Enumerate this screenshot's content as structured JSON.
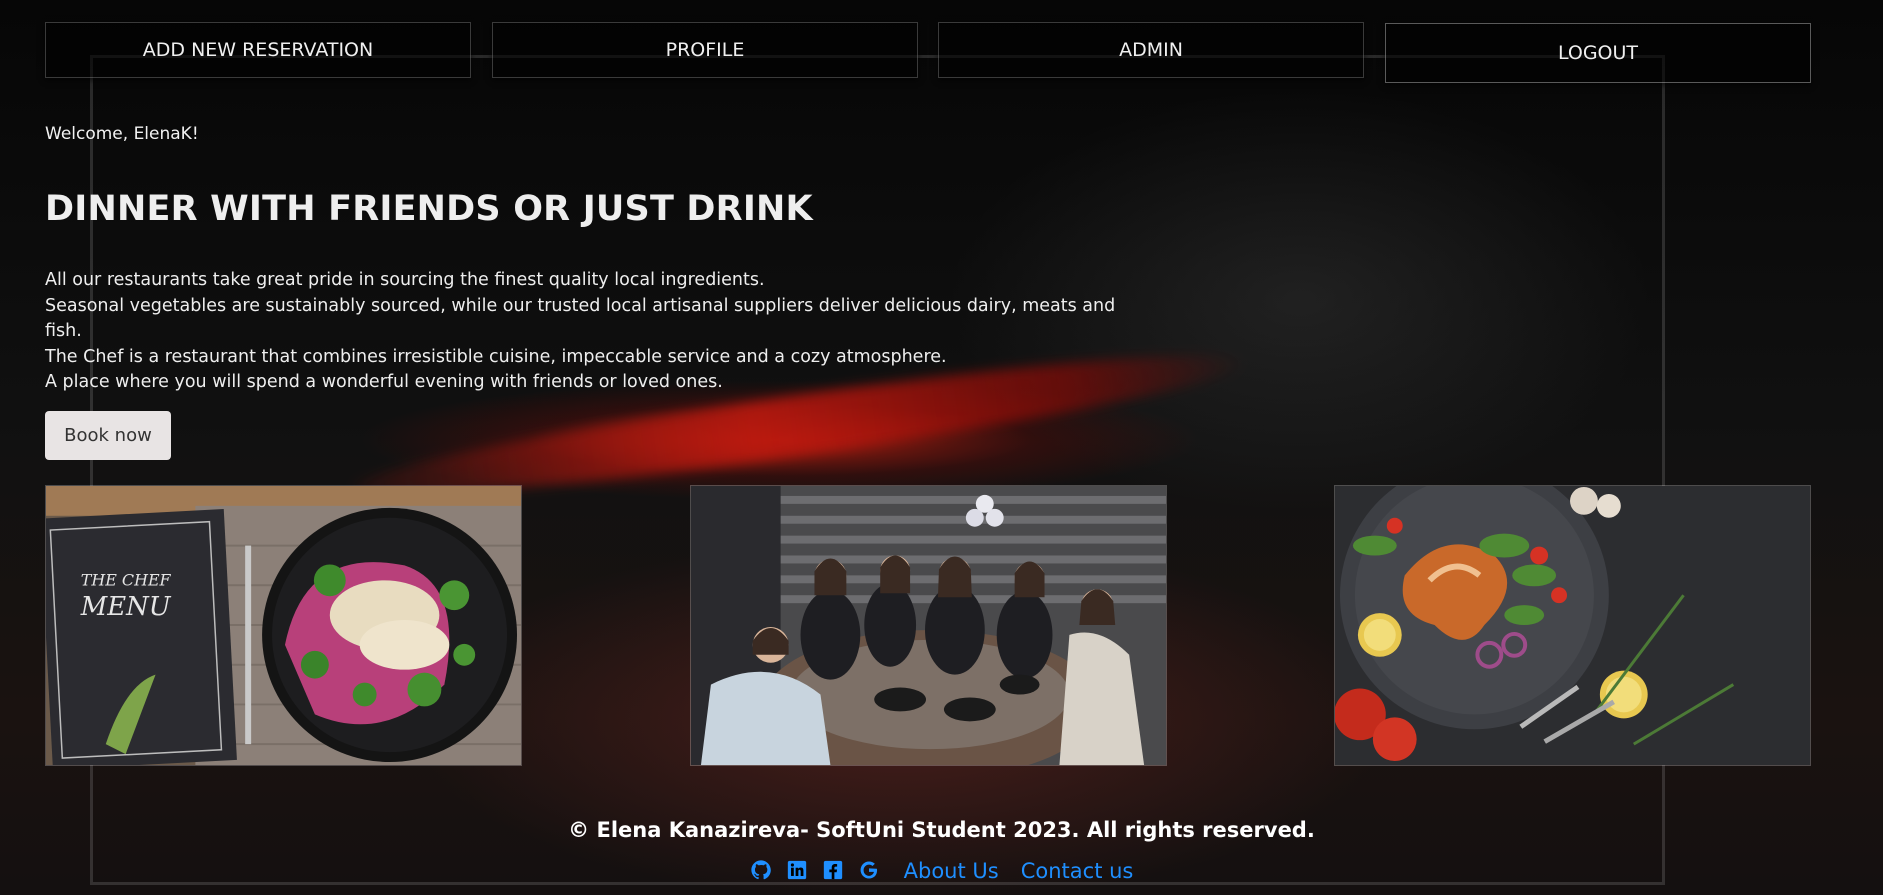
{
  "nav": {
    "add_reservation": "ADD NEW RESERVATION",
    "profile": "PROFILE",
    "admin": "ADMIN",
    "logout": "LOGOUT"
  },
  "welcome": "Welcome, ElenaK!",
  "hero": {
    "title": "DINNER WITH FRIENDS OR JUST DRINK",
    "paragraphs": [
      "All our restaurants take great pride in sourcing the finest quality local ingredients.",
      "Seasonal vegetables are sustainably sourced, while our trusted local artisanal suppliers deliver delicious dairy, meats and fish.",
      "The Chef is a restaurant that combines irresistible cuisine, impeccable service and a cozy atmosphere.",
      "A place where you will spend a wonderful evening with friends or loved ones."
    ],
    "book_button": "Book now"
  },
  "gallery": {
    "menu_card_title": "THE CHEF",
    "menu_card_subtitle": "MENU"
  },
  "footer": {
    "copyright": "© Elena Kanazireva- SoftUni Student 2023. All rights reserved.",
    "icons": [
      "github-icon",
      "linkedin-icon",
      "facebook-icon",
      "google-icon"
    ],
    "about": "About Us",
    "contact": "Contact us"
  },
  "colors": {
    "link": "#1f8fff",
    "book_button_bg": "#e8e4e4",
    "background": "#0b0b0b"
  }
}
